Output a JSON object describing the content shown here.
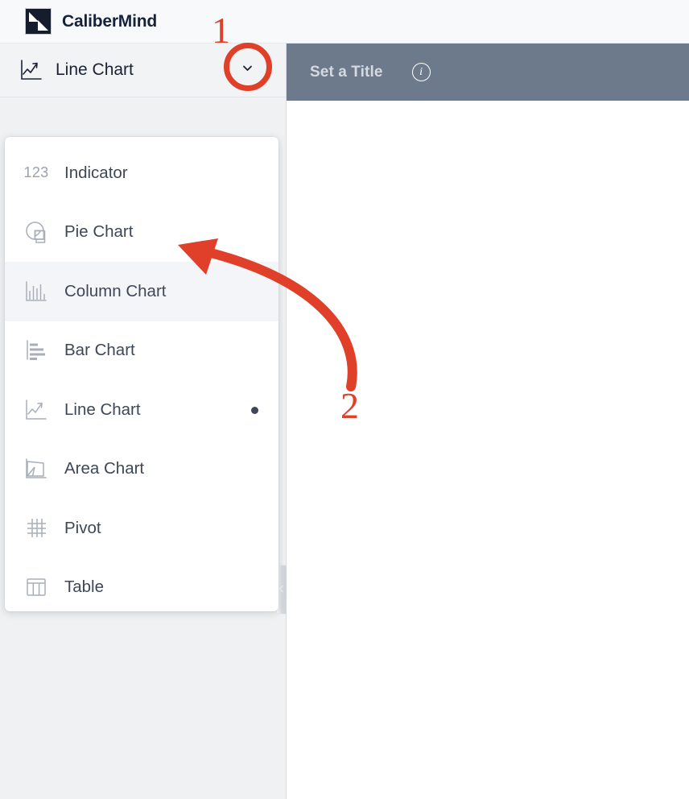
{
  "app": {
    "brand_name": "CaliberMind",
    "logo_icon": "calibermind-logo-icon"
  },
  "selector": {
    "current_label": "Line Chart",
    "icon": "line-chart-icon",
    "toggle_icon": "chevron-down-icon"
  },
  "menu": {
    "items": [
      {
        "label": "Indicator",
        "icon": "indicator-123-icon",
        "glyph": "123",
        "selected": false,
        "hovered": false
      },
      {
        "label": "Pie Chart",
        "icon": "pie-chart-icon",
        "glyph": "",
        "selected": false,
        "hovered": false
      },
      {
        "label": "Column Chart",
        "icon": "column-chart-icon",
        "glyph": "",
        "selected": false,
        "hovered": true
      },
      {
        "label": "Bar Chart",
        "icon": "bar-chart-icon",
        "glyph": "",
        "selected": false,
        "hovered": false
      },
      {
        "label": "Line Chart",
        "icon": "line-chart-icon",
        "glyph": "",
        "selected": true,
        "hovered": false
      },
      {
        "label": "Area Chart",
        "icon": "area-chart-icon",
        "glyph": "",
        "selected": false,
        "hovered": false
      },
      {
        "label": "Pivot",
        "icon": "pivot-icon",
        "glyph": "",
        "selected": false,
        "hovered": false
      },
      {
        "label": "Table",
        "icon": "table-icon",
        "glyph": "",
        "selected": false,
        "hovered": false
      }
    ]
  },
  "content": {
    "title": "Set a Title",
    "info_icon": "info-icon",
    "info_glyph": "i"
  },
  "sidebar": {
    "collapse_icon": "chevron-left-icon"
  },
  "annotations": {
    "step_one": "1",
    "step_two": "2",
    "accent_color": "#e0402a"
  },
  "colors": {
    "brand_dark": "#151c2c",
    "title_bar": "#6d7a8c",
    "panel_bg": "#eff1f3",
    "menu_bg": "#ffffff",
    "hover_bg": "#f4f5f8",
    "text": "#3d4758"
  }
}
